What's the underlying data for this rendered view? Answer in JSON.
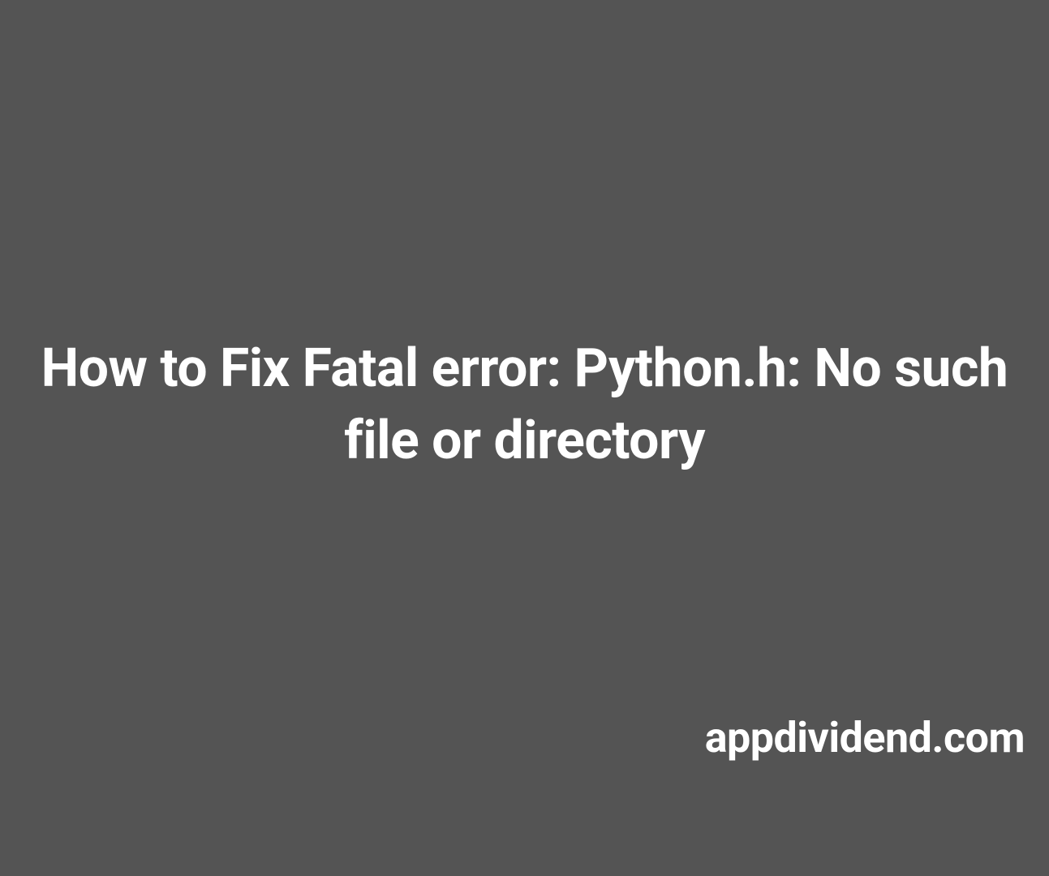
{
  "main": {
    "title": "How to Fix Fatal error: Python.h: No such file or directory"
  },
  "footer": {
    "site": "appdividend.com"
  }
}
